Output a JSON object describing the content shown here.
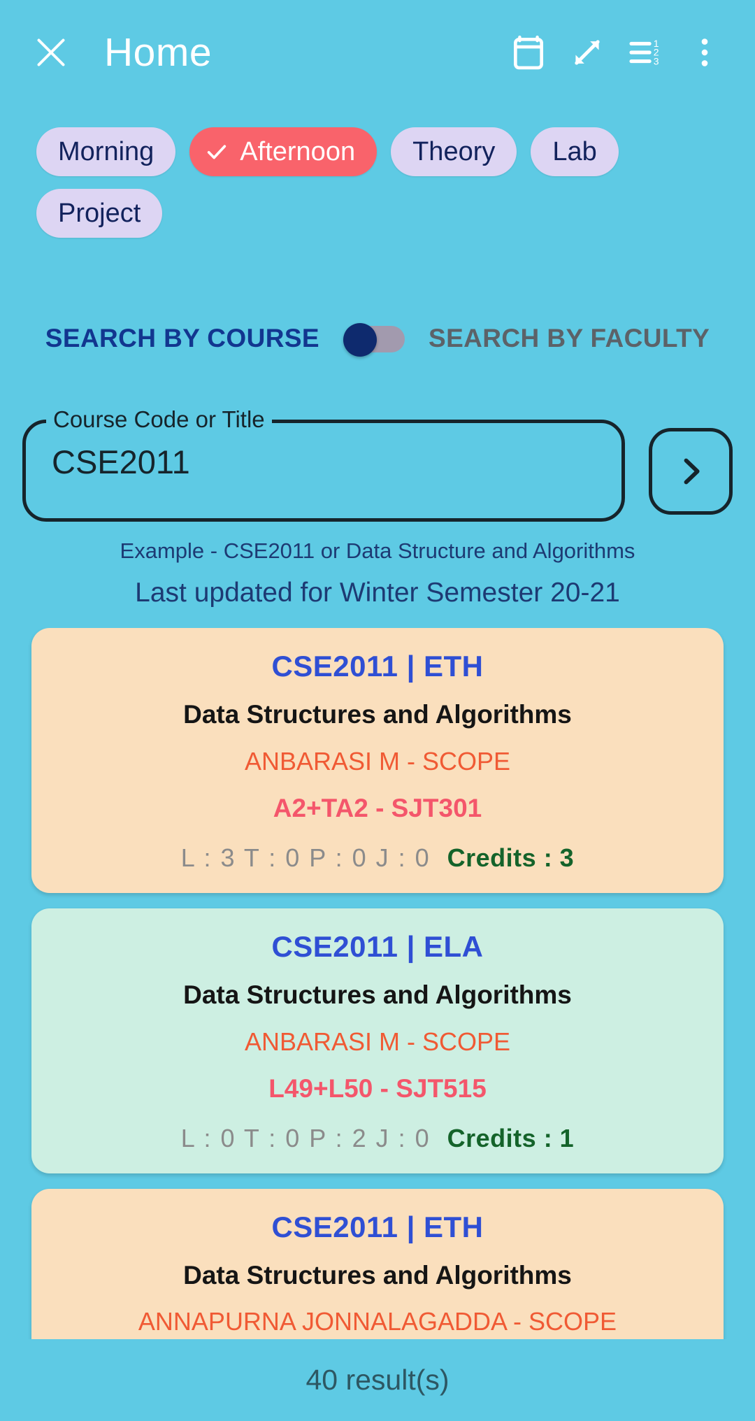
{
  "appbar": {
    "close_icon": "close-icon",
    "title": "Home",
    "actions": [
      {
        "icon": "calendar-icon",
        "name": "timetable-button"
      },
      {
        "icon": "expand-arrows-icon",
        "name": "expand-button"
      },
      {
        "icon": "sort-numeric-icon",
        "name": "sort-button"
      },
      {
        "icon": "kebab-menu-icon",
        "name": "overflow-menu-button"
      }
    ]
  },
  "filters": {
    "chips": [
      {
        "label": "Morning",
        "selected": false
      },
      {
        "label": "Afternoon",
        "selected": true
      },
      {
        "label": "Theory",
        "selected": false
      },
      {
        "label": "Lab",
        "selected": false
      },
      {
        "label": "Project",
        "selected": false
      }
    ],
    "selected_color": "#f9636b",
    "unselected_color": "#ddd5f3"
  },
  "toggle": {
    "left_label": "SEARCH BY COURSE",
    "right_label": "SEARCH BY FACULTY",
    "state": "left",
    "thumb_color": "#0e2a6e",
    "track_color": "#a29aae"
  },
  "search": {
    "field_label": "Course Code or Title",
    "value": "CSE2011",
    "placeholder": "Course Code or Title",
    "go_icon": "chevron-right-icon",
    "example_text": "Example - CSE2011 or Data Structure and Algorithms",
    "updated_text": "Last updated for Winter Semester 20-21"
  },
  "results": {
    "cards": [
      {
        "code": "CSE2011 | ETH",
        "title": "Data Structures and Algorithms",
        "faculty": "ANBARASI M - SCOPE",
        "slot": "A2+TA2 - SJT301",
        "ltpj": "L : 3  T : 0  P : 0  J : 0",
        "credits": "Credits : 3",
        "type": "theory",
        "color": "#fadfbd"
      },
      {
        "code": "CSE2011 | ELA",
        "title": "Data Structures and Algorithms",
        "faculty": "ANBARASI M - SCOPE",
        "slot": "L49+L50 - SJT515",
        "ltpj": "L : 0  T : 0  P : 2  J : 0",
        "credits": "Credits : 1",
        "type": "lab",
        "color": "#cdefe2"
      },
      {
        "code": "CSE2011 | ETH",
        "title": "Data Structures and Algorithms",
        "faculty": "ANNAPURNA JONNALAGADDA - SCOPE",
        "slot": "",
        "ltpj": "",
        "credits": "",
        "type": "theory",
        "color": "#fadfbd"
      }
    ]
  },
  "footer": {
    "result_count_text": "40 result(s)"
  },
  "theme": {
    "background": "#5ecae4",
    "accent_blue": "#2f4fd4",
    "faculty_orange": "#f05a34",
    "slot_pink": "#f4566b",
    "credits_green": "#14632a"
  }
}
